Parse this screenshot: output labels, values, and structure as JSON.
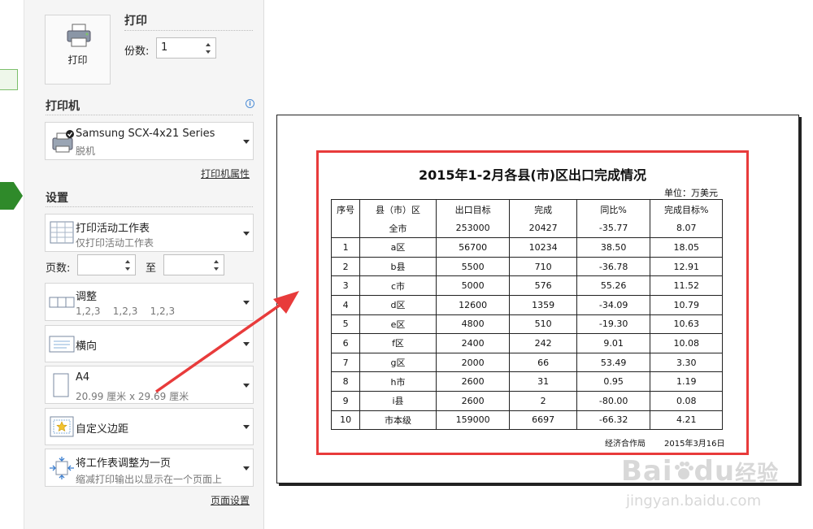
{
  "print": {
    "section_title": "打印",
    "print_button_label": "打印",
    "copies_label": "份数:",
    "copies_value": "1"
  },
  "printer": {
    "section_title": "打印机",
    "name": "Samsung SCX-4x21 Series",
    "status": "脱机",
    "properties_link": "打印机属性"
  },
  "settings": {
    "section_title": "设置",
    "scope_title": "打印活动工作表",
    "scope_sub": "仅打印活动工作表",
    "pages_label": "页数:",
    "pages_to_label": "至",
    "collate_title": "调整",
    "collate_sub": "1,2,3    1,2,3    1,2,3",
    "orientation": "横向",
    "paper_title": "A4",
    "paper_sub": "20.99 厘米 x 29.69 厘米",
    "margins": "自定义边距",
    "scale_title": "将工作表调整为一页",
    "scale_sub": "缩减打印输出以显示在一个页面上",
    "page_setup_link": "页面设置"
  },
  "report": {
    "title": "2015年1-2月各县(市)区出口完成情况",
    "unit": "单位：万美元",
    "headers": [
      "序号",
      "县（市）区",
      "出口目标",
      "完成",
      "同比%",
      "完成目标%"
    ],
    "total_row": [
      "",
      "全市",
      "253000",
      "20427",
      "-35.77",
      "8.07"
    ],
    "rows": [
      [
        "1",
        "a区",
        "56700",
        "10234",
        "38.50",
        "18.05"
      ],
      [
        "2",
        "b县",
        "5500",
        "710",
        "-36.78",
        "12.91"
      ],
      [
        "3",
        "c市",
        "5000",
        "576",
        "55.26",
        "11.52"
      ],
      [
        "4",
        "d区",
        "12600",
        "1359",
        "-34.09",
        "10.79"
      ],
      [
        "5",
        "e区",
        "4800",
        "510",
        "-19.30",
        "10.63"
      ],
      [
        "6",
        "f区",
        "2400",
        "242",
        "9.01",
        "10.08"
      ],
      [
        "7",
        "g区",
        "2000",
        "66",
        "53.49",
        "3.30"
      ],
      [
        "8",
        "h市",
        "2600",
        "31",
        "0.95",
        "1.19"
      ],
      [
        "9",
        "i县",
        "2600",
        "2",
        "-80.00",
        "0.08"
      ],
      [
        "10",
        "市本级",
        "159000",
        "6697",
        "-66.32",
        "4.21"
      ]
    ],
    "footer_org": "经济合作局",
    "footer_date": "2015年3月16日"
  },
  "watermark": {
    "brand": "Bai",
    "brand2": "du",
    "brand_cn": "经验",
    "url": "jingyan.baidu.com"
  },
  "colors": {
    "accent_green": "#2f8a2a",
    "highlight_red": "#e83b3b"
  }
}
